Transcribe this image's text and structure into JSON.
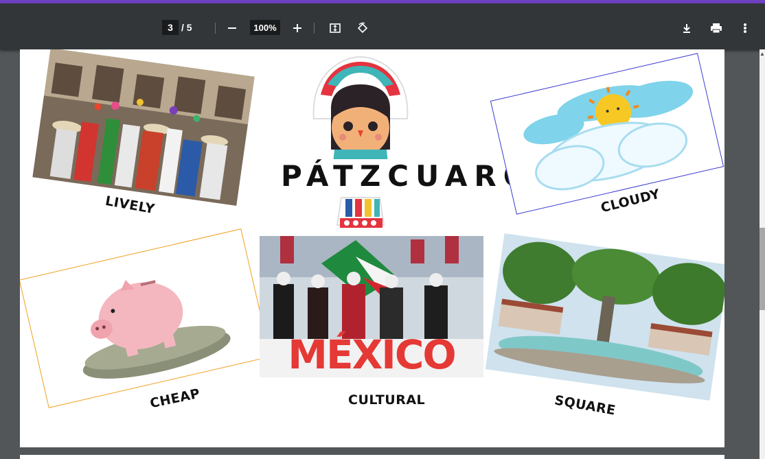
{
  "toolbar": {
    "current_page": "3",
    "page_total": "/ 5",
    "zoom": "100%"
  },
  "icons": {
    "zoom_out": "minus-icon",
    "zoom_in": "plus-icon",
    "fit": "fit-page-icon",
    "rotate": "rotate-icon",
    "download": "download-icon",
    "print": "print-icon",
    "more": "more-vert-icon"
  },
  "page": {
    "title": "PÁTZCUARO",
    "captions": {
      "lively": "LIVELY",
      "cloudy": "CLOUDY",
      "cheap": "CHEAP",
      "cultural": "CULTURAL",
      "square": "SQUARE"
    },
    "sign_text": "MÉXICO"
  },
  "colors": {
    "accent": "#6f42c1",
    "toolbar": "#323639",
    "viewer_bg": "#525659"
  }
}
